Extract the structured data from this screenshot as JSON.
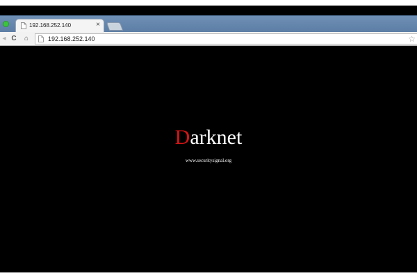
{
  "browser": {
    "tab": {
      "title": "192.168.252.140",
      "close_glyph": "×",
      "icon": "page-icon"
    },
    "toolbar": {
      "back_glyph": "◂",
      "reload_glyph": "C",
      "home_glyph": "⌂",
      "url": "192.168.252.140",
      "star_glyph": "☆"
    }
  },
  "page": {
    "heading_first_letter": "D",
    "heading_rest": "arknet",
    "subtext": "www.securitysignal.org",
    "colors": {
      "background": "#000000",
      "heading": "#ffffff",
      "heading_accent": "#d41414"
    }
  }
}
